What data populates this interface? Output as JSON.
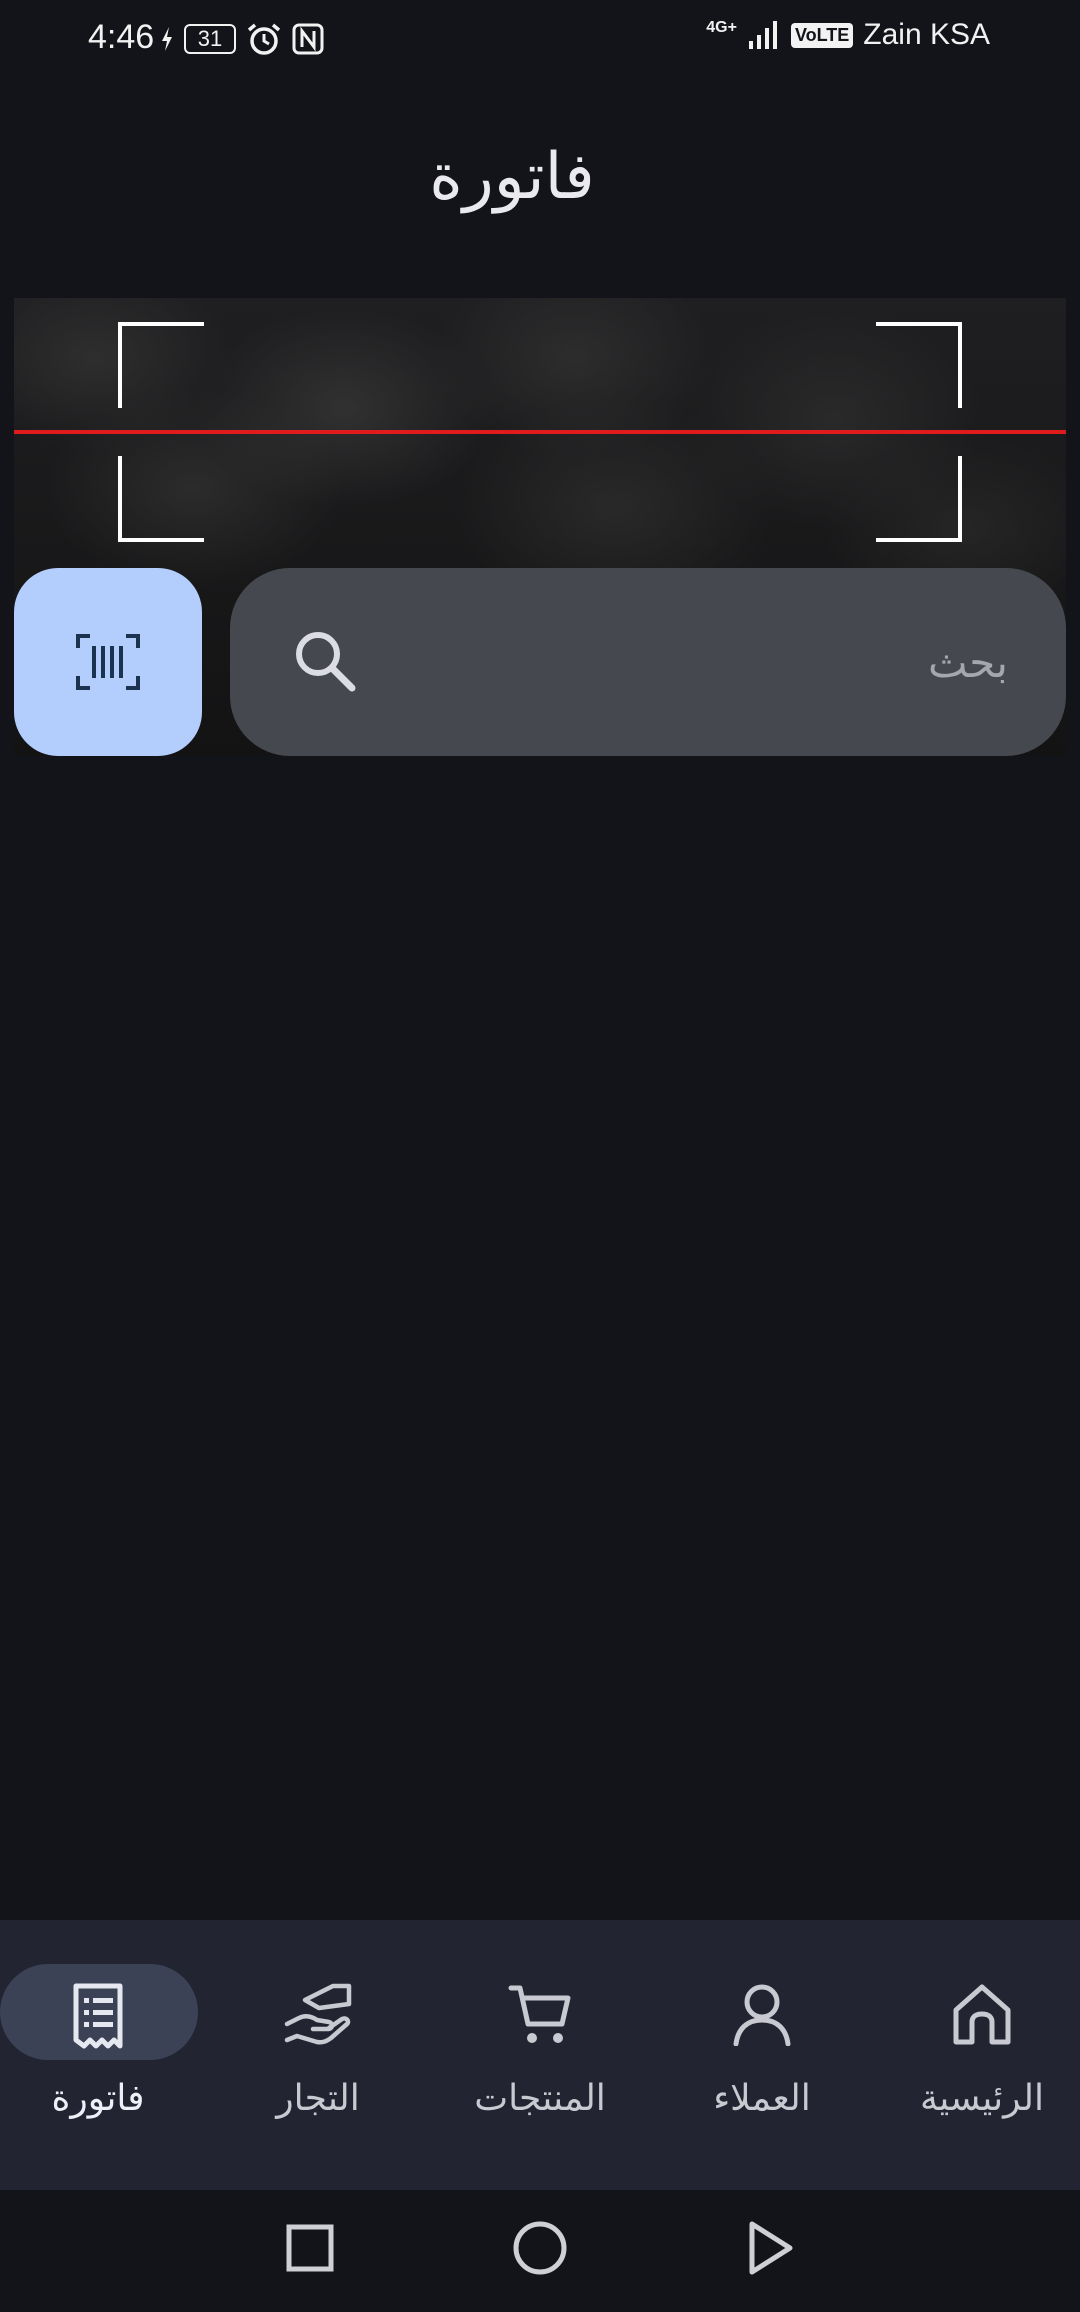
{
  "status_bar": {
    "time": "4:46",
    "battery_level": "31",
    "network": "4G+",
    "volte": "VoLTE",
    "carrier": "Zain KSA"
  },
  "header": {
    "title": "فاتورة"
  },
  "scanner": {
    "scan_line_color": "#e01b1b",
    "barcode_button_color": "#b3cdfd"
  },
  "search": {
    "placeholder": "بحث",
    "value": ""
  },
  "bottom_nav": {
    "active_index": 4,
    "items": [
      {
        "label": "الرئيسية",
        "icon": "home-icon"
      },
      {
        "label": "العملاء",
        "icon": "person-icon"
      },
      {
        "label": "المنتجات",
        "icon": "cart-icon"
      },
      {
        "label": "التجار",
        "icon": "hand-icon"
      },
      {
        "label": "فاتورة",
        "icon": "receipt-icon"
      }
    ]
  },
  "system_nav": {
    "buttons": [
      "recents",
      "home",
      "back"
    ]
  }
}
